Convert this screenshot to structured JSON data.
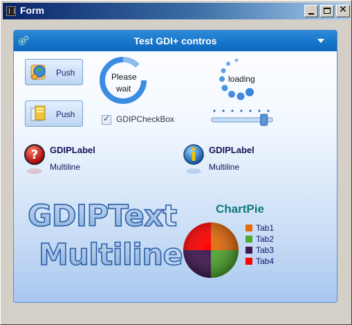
{
  "window": {
    "title": "Form"
  },
  "panel": {
    "title": "Test GDI+ contros"
  },
  "buttons": [
    {
      "label": "Push"
    },
    {
      "label": "Push"
    }
  ],
  "spinner": {
    "line1": "Please",
    "line2": "wait"
  },
  "loading": {
    "text": "loading"
  },
  "checkbox": {
    "label": "GDIPCheckBox",
    "checked": true
  },
  "slider": {
    "value": 0.86
  },
  "labels": [
    {
      "title": "GDIPLabel",
      "subtitle": "Multiline",
      "icon": "question-icon"
    },
    {
      "title": "GDIPLabel",
      "subtitle": "Multiline",
      "icon": "info-icon"
    }
  ],
  "gdiptext": {
    "line1": "GDIPText",
    "line2": "Multiline"
  },
  "chart_data": {
    "type": "pie",
    "title": "ChartPie",
    "categories": [
      "Tab1",
      "Tab2",
      "Tab3",
      "Tab4"
    ],
    "values": [
      25,
      25,
      25,
      25
    ],
    "colors": [
      "#e46c0a",
      "#4ea72e",
      "#3e1650",
      "#ff0000"
    ]
  }
}
